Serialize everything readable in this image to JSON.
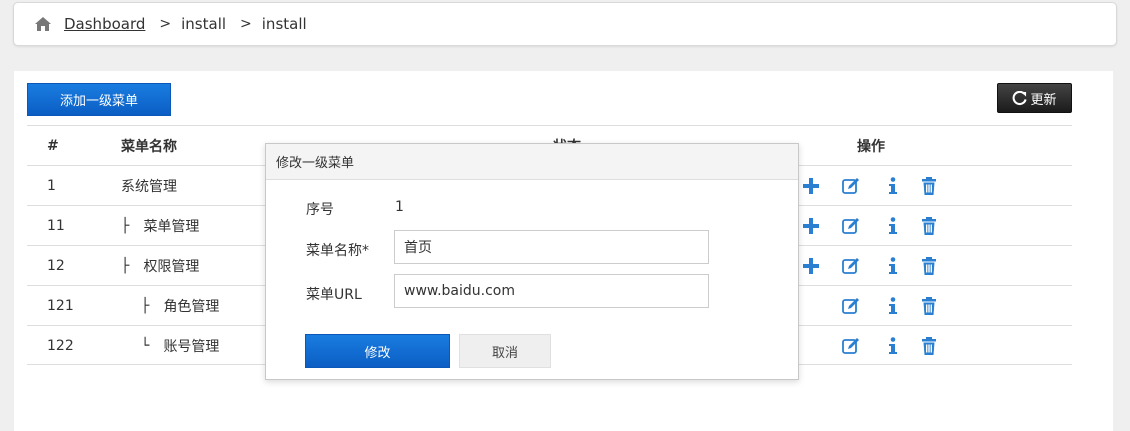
{
  "breadcrumb": {
    "home_icon": "home-icon",
    "items": [
      "Dashboard",
      "install",
      "install"
    ],
    "separator": ">"
  },
  "toolbar": {
    "add_label": "添加一级菜单",
    "refresh_label": "更新",
    "refresh_icon": "refresh-icon"
  },
  "table": {
    "headers": [
      "#",
      "菜单名称",
      "状态",
      "操作"
    ],
    "rows": [
      {
        "id": "1",
        "name": "系统管理",
        "prefix": "",
        "has_add": true
      },
      {
        "id": "11",
        "name": "菜单管理",
        "prefix": "├",
        "has_add": true
      },
      {
        "id": "12",
        "name": "权限管理",
        "prefix": "├",
        "has_add": true
      },
      {
        "id": "121",
        "name": "角色管理",
        "prefix": "├",
        "has_add": false
      },
      {
        "id": "122",
        "name": "账号管理",
        "prefix": "└",
        "has_add": false
      }
    ]
  },
  "modal": {
    "title": "修改一级菜单",
    "seq_label": "序号",
    "seq_value": "1",
    "name_label": "菜单名称*",
    "name_value": "首页",
    "url_label": "菜单URL",
    "url_value": "www.baidu.com",
    "ok_label": "修改",
    "cancel_label": "取消"
  },
  "colors": {
    "primary": "#0b5ec4",
    "icon_blue": "#2a7fd0",
    "dark_button": "#1b1b1b"
  }
}
